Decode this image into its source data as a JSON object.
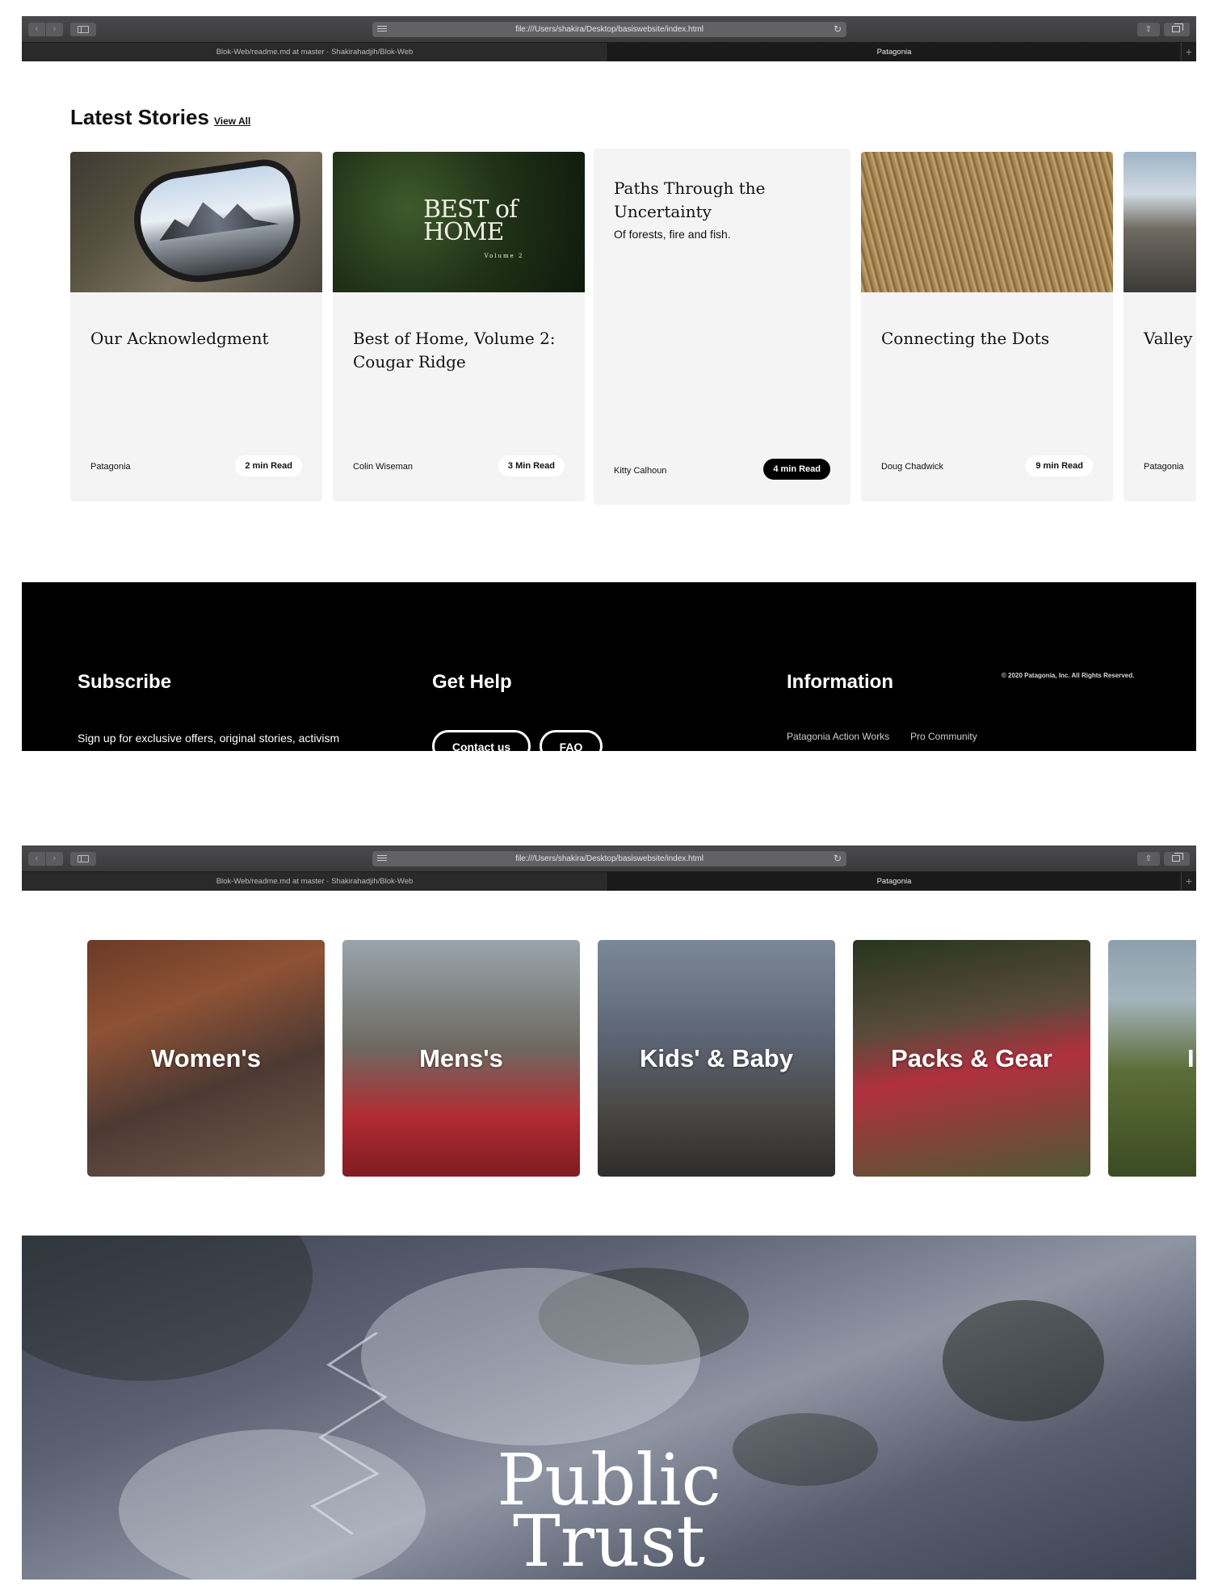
{
  "browser": {
    "url": "file:///Users/shakira/Desktop/basiswebsite/index.html",
    "tabs": [
      {
        "label": "Blok-Web/readme.md at master · Shakirahadjih/Blok-Web"
      },
      {
        "label": "Patagonia"
      }
    ],
    "tab_add": "+"
  },
  "stories": {
    "title": "Latest Stories",
    "view_all": "View All",
    "cards": [
      {
        "title": "Our Acknowledgment",
        "author": "Patagonia",
        "read": "2 min Read"
      },
      {
        "title": "Best of Home, Volume 2: Cougar Ridge",
        "author": "Colin Wiseman",
        "read": "3 Min Read",
        "image_text": "BEST of HOME",
        "image_sub": "Volume 2"
      },
      {
        "title": "Paths Through the Uncertainty",
        "subtitle": "Of forests, fire and fish.",
        "author": "Kitty Calhoun",
        "read": "4 min Read"
      },
      {
        "title": "Connecting the Dots",
        "author": "Doug Chadwick",
        "read": "9 min Read"
      },
      {
        "title": "Valley S",
        "author": "Patagonia"
      }
    ]
  },
  "footer": {
    "subscribe": {
      "title": "Subscribe",
      "text": "Sign up for exclusive offers, original stories, activism"
    },
    "help": {
      "title": "Get Help",
      "contact": "Contact us",
      "faq": "FAQ"
    },
    "info": {
      "title": "Information",
      "links": [
        "Patagonia Action Works",
        "Pro Community"
      ]
    },
    "copyright": "© 2020 Patagonia, Inc. All Rights Reserved."
  },
  "categories": [
    {
      "label": "Women's"
    },
    {
      "label": "Mens's"
    },
    {
      "label": "Kids' & Baby"
    },
    {
      "label": "Packs & Gear"
    },
    {
      "label": "I"
    }
  ],
  "hero": {
    "title_line1": "Public",
    "title_line2": "Trust"
  },
  "icons": {
    "back": "chevron-left-icon",
    "forward": "chevron-right-icon",
    "sidebar": "sidebar-icon",
    "reader": "reader-icon",
    "reload": "reload-icon",
    "share": "share-icon",
    "tabs": "tabs-icon"
  }
}
